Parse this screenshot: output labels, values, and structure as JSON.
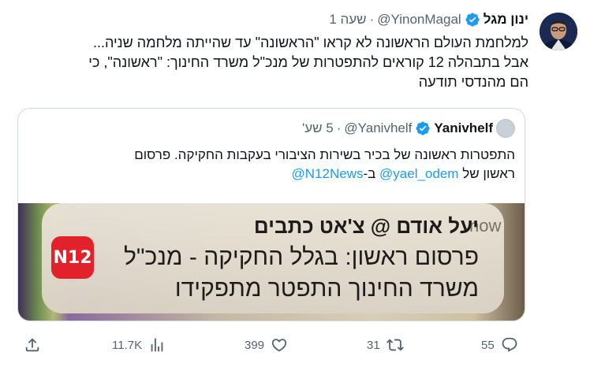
{
  "author": {
    "name": "ינון מגל",
    "handle": "@YinonMagal",
    "separator": "·",
    "time": "שעה 1"
  },
  "tweet": {
    "text_lines": [
      "למלחמת העולם הראשונה לא קראו \"הראשונה\" עד שהייתה מלחמה שניה...",
      "אבל בתבהלה 12 קוראים להתפטרות של מנכ\"ל משרד החינוך: \"ראשונה\", כי",
      "הם מהנדסי תודעה"
    ]
  },
  "quoted": {
    "name": "Yanivhelf",
    "handle": "@Yanivhelf",
    "separator": "·",
    "time": "5 שע'",
    "text_line1": "התפטרות ראשונה של בכיר בשירות הציבורי בעקבות החקיקה. פרסום",
    "text_line2_prefix": "ראשון של ",
    "mention1": "@yael_odem",
    "text_line2_mid": " ב-",
    "mention2": "@N12News"
  },
  "notification": {
    "app_label": "N12",
    "time": "now",
    "title": "יעל אודם @ צ'אט כתבים",
    "line1": "פרסום ראשון: בגלל החקיקה - מנכ\"ל",
    "line2": "משרד החינוך התפטר מתפקידו"
  },
  "actions": {
    "replies": "55",
    "retweets": "31",
    "likes": "399",
    "views": "11.7K"
  },
  "colors": {
    "verified": "#1d9bf0",
    "secondary_text": "#536471",
    "border": "#cfd9de",
    "n12_red": "#e1222a"
  },
  "icons": [
    "verified-badge-icon",
    "reply-icon",
    "retweet-icon",
    "like-icon",
    "views-icon",
    "share-icon"
  ]
}
